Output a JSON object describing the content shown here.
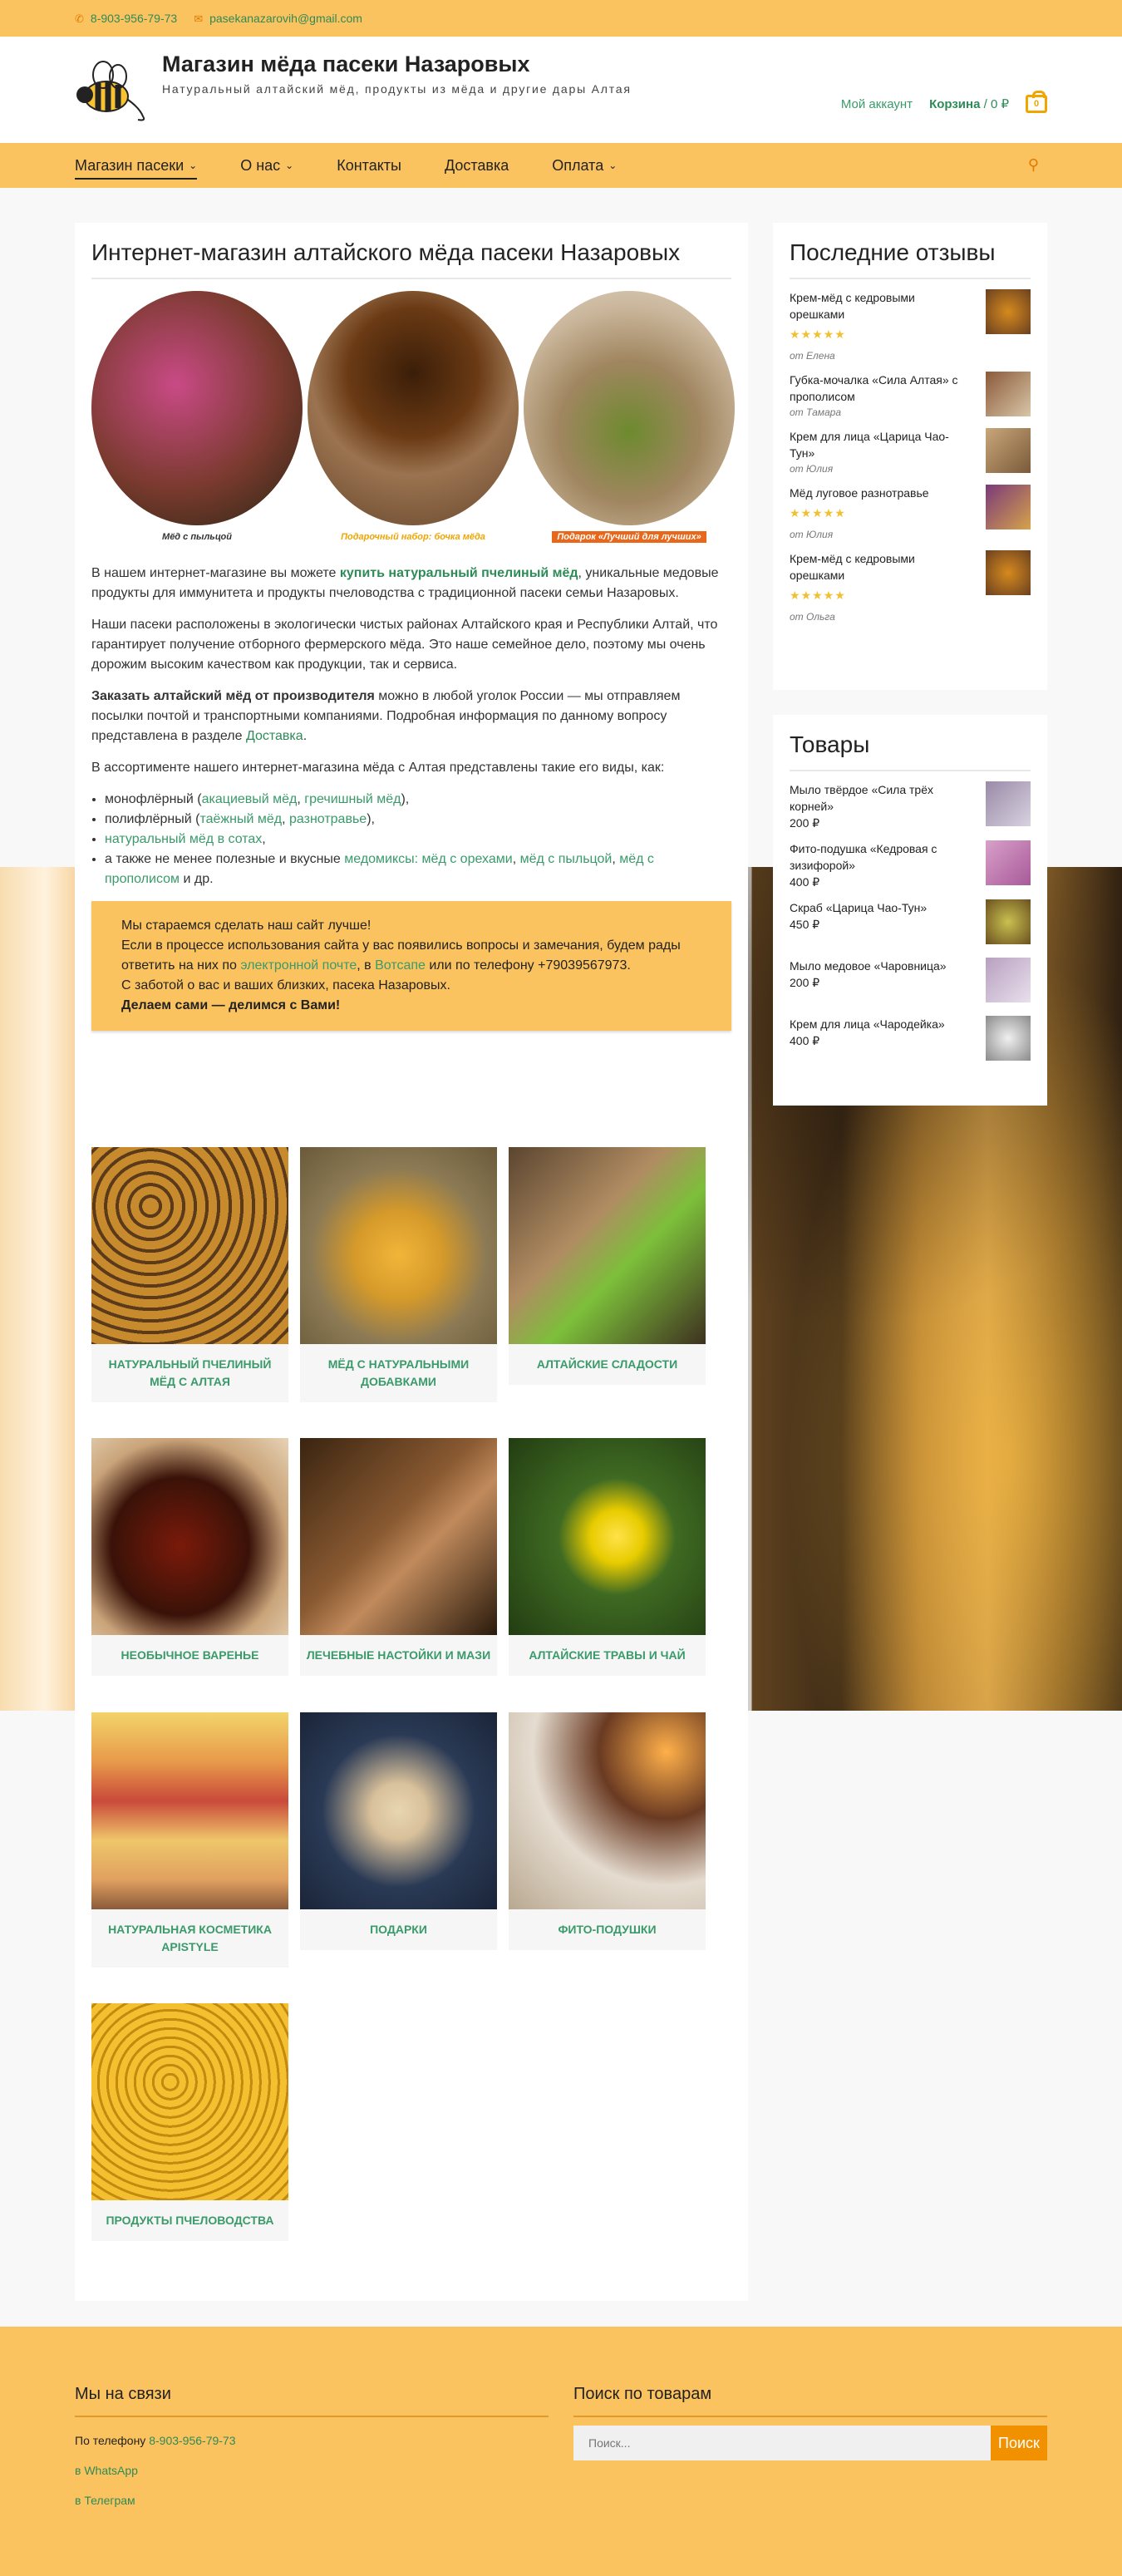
{
  "topbar": {
    "phone": "8-903-956-79-73",
    "email": "pasekanazarovih@gmail.com"
  },
  "header": {
    "title": "Магазин мёда пасеки Назаровых",
    "tagline": "Натуральный алтайский мёд, продукты из мёда и другие дары Алтая",
    "account": "Мой аккаунт",
    "cart_label": "Корзина",
    "cart_sum": "/ 0 ₽",
    "cart_count": "0"
  },
  "nav": {
    "items": [
      {
        "label": "Магазин пасеки",
        "has_sub": true
      },
      {
        "label": "О нас",
        "has_sub": true
      },
      {
        "label": "Контакты",
        "has_sub": false
      },
      {
        "label": "Доставка",
        "has_sub": false
      },
      {
        "label": "Оплата",
        "has_sub": true
      }
    ]
  },
  "main": {
    "title": "Интернет-магазин алтайского мёда пасеки Назаровых",
    "captions": [
      "Мёд с пыльцой",
      "Подарочный набор: бочка мёда",
      "Подарок «Лучший для лучших»"
    ],
    "p1_a": "В нашем интернет-магазине вы можете ",
    "p1_link": "купить натуральный пчелиный мёд",
    "p1_b": ", уникальные медовые продукты для иммунитета и продукты пчеловодства с традиционной пасеки семьи Назаровых.",
    "p2": "Наши пасеки расположены в экологически чистых районах Алтайского края и Республики Алтай, что гарантирует получение отборного фермерского мёда. Это наше семейное дело, поэтому мы очень дорожим высоким качеством как продукции, так и сервиса.",
    "p3_bold": "Заказать алтайский мёд от производителя",
    "p3_text": " можно в любой уголок России — мы отправляем посылки почтой и транспортными компаниями. Подробная информация по данному вопросу представлена в разделе ",
    "p3_link": "Доставка",
    "p3_end": ".",
    "p4": "В ассортименте нашего интернет-магазина мёда с Алтая представлены такие его виды, как:",
    "list": {
      "l1_a": "монофлёрный (",
      "l1_link1": "акациевый мёд",
      "l1_sep": ", ",
      "l1_link2": "гречишный мёд",
      "l1_end": "),",
      "l2_a": "полифлёрный (",
      "l2_link1": "таёжный мёд",
      "l2_sep": ", ",
      "l2_link2": "разнотравье",
      "l2_end": "),",
      "l3_link": "натуральный мёд в сотах",
      "l3_end": ",",
      "l4_a": "а также не менее полезные и вкусные ",
      "l4_link1": "медомиксы: мёд с орехами",
      "l4_sep1": ", ",
      "l4_link2": "мёд с пыльцой",
      "l4_sep2": ", ",
      "l4_link3": "мёд с прополисом",
      "l4_end": " и др."
    },
    "notice": {
      "l1": "Мы стараемся сделать наш сайт лучше!",
      "l2": "Если в процессе использования сайта у вас появились вопросы и замечания, будем рады ответить на них по ",
      "l2_link1": "электронной почте",
      "l2_mid": ", в ",
      "l2_link2": "Вотсапе",
      "l2_end": " или по телефону +79039567973.",
      "l3": "С заботой о вас и ваших близких, пасека Назаровых.",
      "l4": "Делаем сами — делимся с Вами!"
    },
    "categories": [
      "Натуральный пчелиный мёд с Алтая",
      "Мёд с натуральными добавками",
      "Алтайские сладости",
      "Необычное варенье",
      "Лечебные настойки и мази",
      "Алтайские травы и чай",
      "Натуральная косметика APISTYLE",
      "Подарки",
      "Фито-подушки",
      "Продукты пчеловодства"
    ]
  },
  "reviews": {
    "title": "Последние отзывы",
    "items": [
      {
        "name": "Крем-мёд с кедровыми орешками",
        "stars": "★★★★★",
        "by": "от Елена",
        "rating": 5
      },
      {
        "name": "Губка-мочалка «Сила Алтая» с прополисом",
        "stars": "",
        "by": "от Тамара"
      },
      {
        "name": "Крем для лица «Царица Чао-Тун»",
        "stars": "",
        "by": "от Юлия"
      },
      {
        "name": "Мёд луговое разнотравье",
        "stars": "★★★★★",
        "by": "от Юлия",
        "rating": 5
      },
      {
        "name": "Крем-мёд с кедровыми орешками",
        "stars": "★★★★★",
        "by": "от Ольга",
        "rating": 5
      }
    ]
  },
  "products": {
    "title": "Товары",
    "items": [
      {
        "name": "Мыло твёрдое «Сила трёх корней»",
        "price": "200 ₽"
      },
      {
        "name": "Фито-подушка «Кедровая с зизифорой»",
        "price": "400 ₽"
      },
      {
        "name": "Скраб «Царица Чао-Тун»",
        "price": "450 ₽"
      },
      {
        "name": "Мыло медовое «Чаровница»",
        "price": "200 ₽"
      },
      {
        "name": "Крем для лица «Чародейка»",
        "price": "400 ₽"
      }
    ]
  },
  "footer": {
    "contact_title": "Мы на связи",
    "phone_label": "По телефону ",
    "phone": "8-903-956-79-73",
    "whatsapp": "в WhatsApp",
    "telegram": "в Телеграм",
    "search_title": "Поиск по товарам",
    "search_placeholder": "Поиск...",
    "search_button": "Поиск"
  },
  "colors": {
    "accent": "#fbc35f",
    "link": "#3a9a6a",
    "button": "#f29100"
  }
}
